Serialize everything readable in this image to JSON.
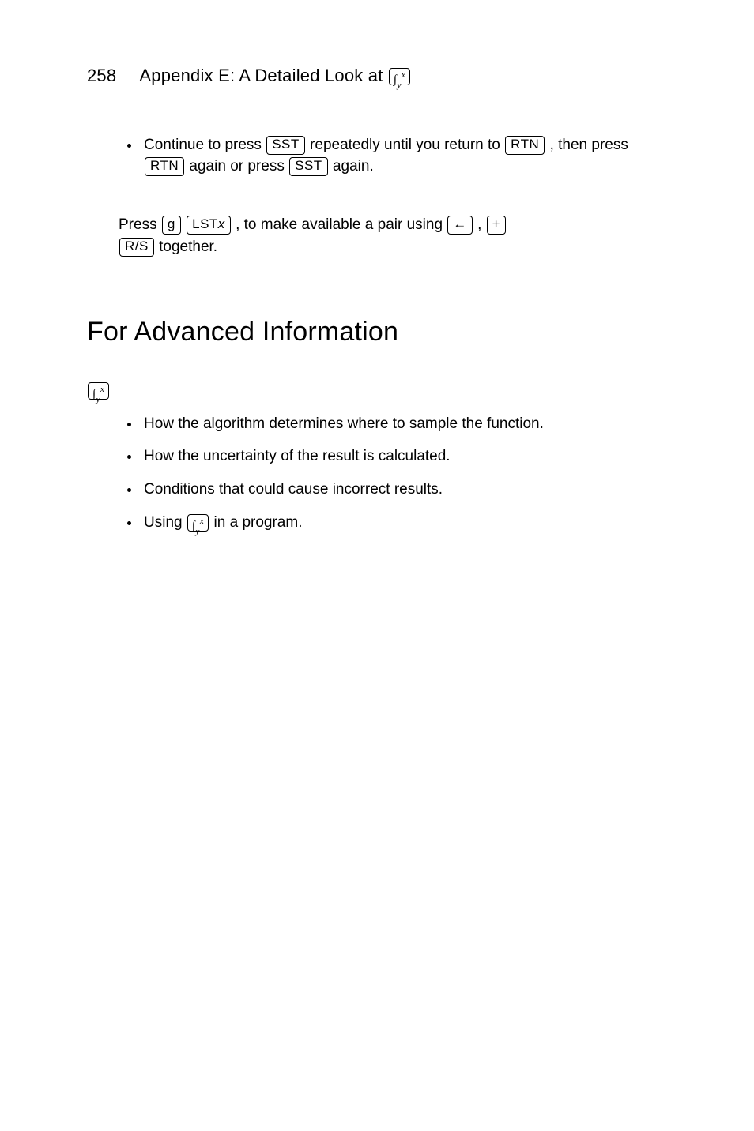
{
  "header": {
    "page_number": "258",
    "title_prefix": "Appendix E: A Detailed Look at ",
    "title_key": "∫ʸˣ"
  },
  "bullets1": {
    "b1_a": "Continue to press ",
    "b1_key1": "SST",
    "b1_b": " repeatedly until you return to ",
    "b1_key2": "RTN",
    "b1_c": ", then press ",
    "b1_key3": "RTN",
    "b1_d": " again or press ",
    "b1_key4": "SST",
    "b1_e": " again."
  },
  "note": {
    "n1_a": "Press ",
    "n1_key1": "g",
    "n1_key2": "LSTx",
    "n1_b": ", to make available a pair using ",
    "n1_key3": "←",
    "n1_c": ", ",
    "n1_key4": "+",
    "n1_key5": "R/S",
    "n1_d": " together."
  },
  "section_heading": "For Advanced Information",
  "adv_intro_a": "",
  "adv_intro_key": "∫ʸˣ",
  "adv_intro_b": "",
  "adv": {
    "li1": "How the algorithm determines where to sample the function.",
    "li2": "How the uncertainty of the result is calculated.",
    "li3": "Conditions that could cause incorrect results.",
    "li4_a": "Using ",
    "li4_key": "∫ʸˣ",
    "li4_b": " in a program."
  }
}
